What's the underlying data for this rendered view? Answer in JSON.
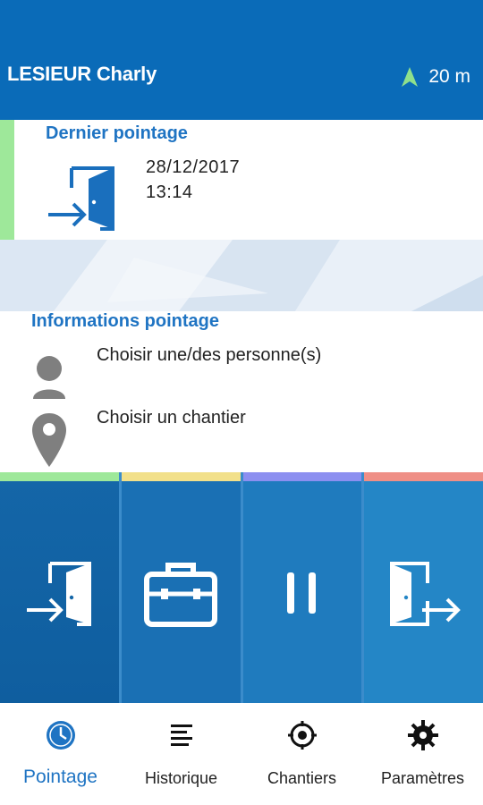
{
  "header": {
    "user_name": "LESIEUR Charly",
    "gps_accuracy": "20 m",
    "background_color": "#0a6bb8"
  },
  "last_clock": {
    "title": "Dernier pointage",
    "date": "28/12/2017",
    "time": "13:14",
    "icon": "door-enter-icon",
    "accent_color": "#9ee89a"
  },
  "info": {
    "title": "Informations pointage",
    "choose_person": "Choisir une/des personne(s)",
    "choose_site": "Choisir un chantier",
    "person_icon": "person-icon",
    "site_icon": "location-pin-icon"
  },
  "actions": [
    {
      "name": "clock-in",
      "icon": "door-enter-icon",
      "bar_color": "#9ee89a"
    },
    {
      "name": "work",
      "icon": "briefcase-icon",
      "bar_color": "#f2e08a"
    },
    {
      "name": "pause",
      "icon": "pause-icon",
      "bar_color": "#8c8ff0"
    },
    {
      "name": "clock-out",
      "icon": "door-exit-icon",
      "bar_color": "#ef8f86"
    }
  ],
  "nav": [
    {
      "label": "Pointage",
      "icon": "clock-icon",
      "active": true
    },
    {
      "label": "Historique",
      "icon": "list-icon",
      "active": false
    },
    {
      "label": "Chantiers",
      "icon": "target-icon",
      "active": false
    },
    {
      "label": "Paramètres",
      "icon": "gear-icon",
      "active": false
    }
  ],
  "colors": {
    "accent_blue": "#1f74c3",
    "text_dark": "#222222"
  }
}
